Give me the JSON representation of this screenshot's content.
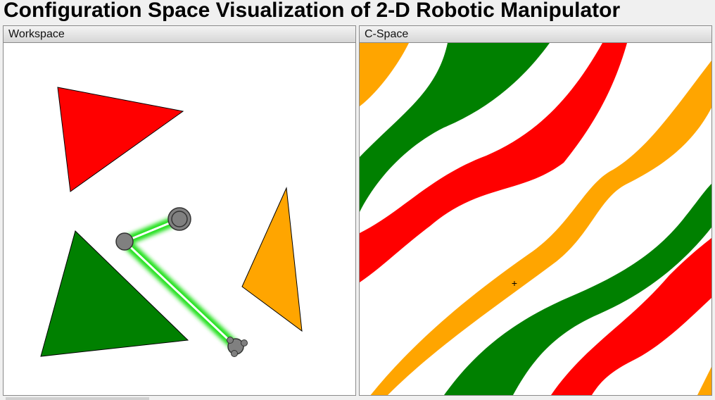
{
  "app": {
    "title": "Configuration Space Visualization of 2-D Robotic Manipulator"
  },
  "workspace": {
    "label": "Workspace",
    "obstacles": [
      {
        "name": "red-triangle",
        "color": "#ff0000"
      },
      {
        "name": "green-triangle",
        "color": "#008000"
      },
      {
        "name": "orange-triangle",
        "color": "#ffa500"
      }
    ],
    "arm": {
      "link_color": "#22e01a",
      "joint_color": "#808080"
    }
  },
  "cspace": {
    "label": "C-Space",
    "band_colors": {
      "red": "#ff0000",
      "green": "#008000",
      "orange": "#ffa500"
    },
    "cursor_glyph": "+"
  }
}
